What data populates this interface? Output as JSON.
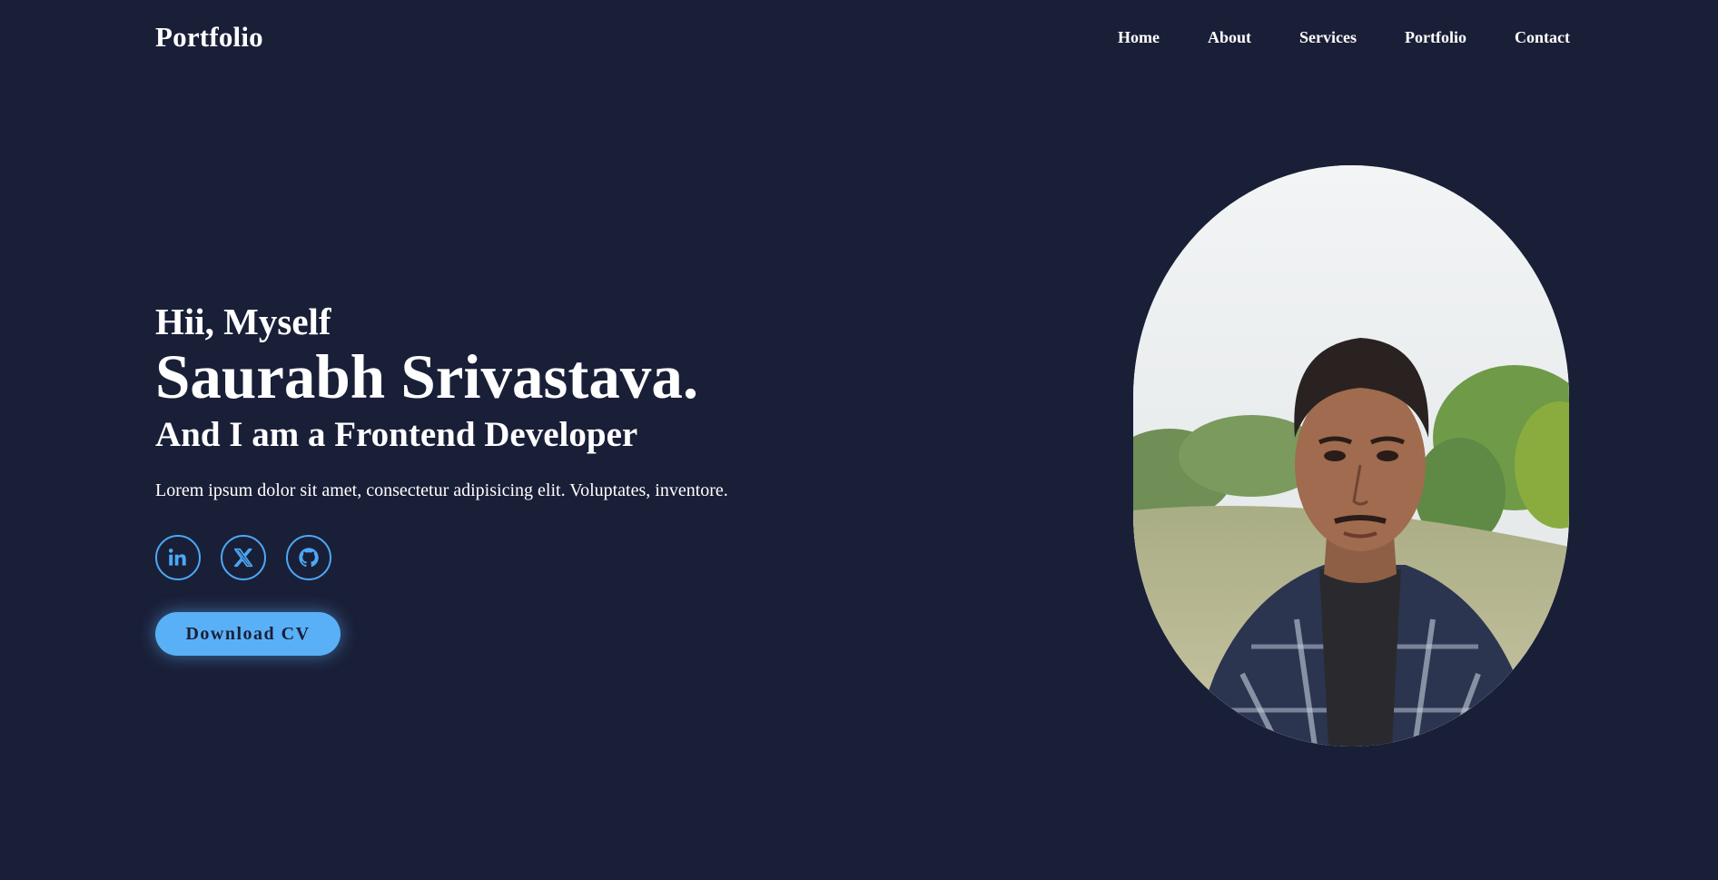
{
  "header": {
    "logo": "Portfolio",
    "nav": [
      {
        "label": "Home"
      },
      {
        "label": "About"
      },
      {
        "label": "Services"
      },
      {
        "label": "Portfolio"
      },
      {
        "label": "Contact"
      }
    ]
  },
  "hero": {
    "greeting": "Hii, Myself",
    "name": "Saurabh Srivastava.",
    "role": "And I am a Frontend Developer",
    "description": "Lorem ipsum dolor sit amet, consectetur adipisicing elit. Voluptates, inventore.",
    "socials": [
      {
        "icon": "linkedin-icon"
      },
      {
        "icon": "x-twitter-icon"
      },
      {
        "icon": "github-icon"
      }
    ],
    "cta_label": "Download CV"
  },
  "colors": {
    "background": "#1a1f38",
    "accent": "#5ab0f6",
    "text": "#ffffff"
  }
}
